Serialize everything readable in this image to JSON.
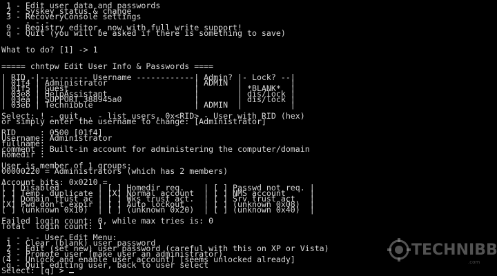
{
  "terminal": {
    "lines": [
      " 1 - Edit user data and passwords",
      " 2 - Syskey status & change",
      " 3 - RecoveryConsole settings",
      "     - - -",
      " 9 - Registry editor, now with full write support!",
      " q - Quit (you will be asked if there is something to save)",
      "",
      "",
      "What to do? [1] -> 1",
      "",
      "",
      "===== chntpw Edit User Info & Passwords ====",
      "",
      "| RID -|---------- Username ------------| Admin? |- Lock? --|",
      "| 01f4 | Administrator                  | ADMIN  |          |",
      "| 01f5 | Guest                          |        | *BLANK*  |",
      "| 03e8 | HelpAssistant                  |        | dis/lock |",
      "| 03ea | SUPPORT_388945a0               |        | dis/lock |",
      "| 03eb | Technibble                     | ADMIN  |          |",
      "",
      "Select: ! - quit, . - list users, 0x<RID> - User with RID (hex)",
      "or simply enter the username to change: [Administrator]",
      "",
      "RID     : 0500 [01f4]",
      "Username: Administrator",
      "fullname:",
      "comment : Built-in account for administering the computer/domain",
      "homedir :",
      "",
      "User is member of 1 groups:",
      "00000220 = Administrators (which has 2 members)",
      "",
      "Account bits: 0x0210 =",
      "[ ] Disabled        | [ ] Homedir req.    | [ ] Passwd not req. |",
      "[ ] Temp. duplicate | [X] Normal account  | [ ] NMS account     |",
      "[ ] Domain trust ac | [ ] Wks trust act.  | [ ] Srv trust act   |",
      "[X] Pwd don't expir | [ ] Auto lockout    | [ ] (unknown 0x08)  |",
      "[ ] (unknown 0x10)  | [ ] (unknown 0x20)  | [ ] (unknown 0x40)  |",
      "",
      "Failed login count: 0, while max tries is: 0",
      "Total  login count: 1",
      "",
      " - - - - User Edit Menu:",
      " 1 - Clear (blank) user password",
      " 2 - Edit (set new) user password (careful with this on XP or Vista)",
      " 3 - Promote user (make user an administrator)",
      "(4 - Unlock and enable user account) [seems unlocked already]",
      " q - Quit editing user, back to user select",
      "Select: [q] > "
    ]
  },
  "watermark": {
    "brand_text": "TECHNIBBLE",
    "sub_text": ".com",
    "icon": "technibble-logo-icon"
  },
  "colors": {
    "background": "#000000",
    "text": "#d8d8d8"
  }
}
